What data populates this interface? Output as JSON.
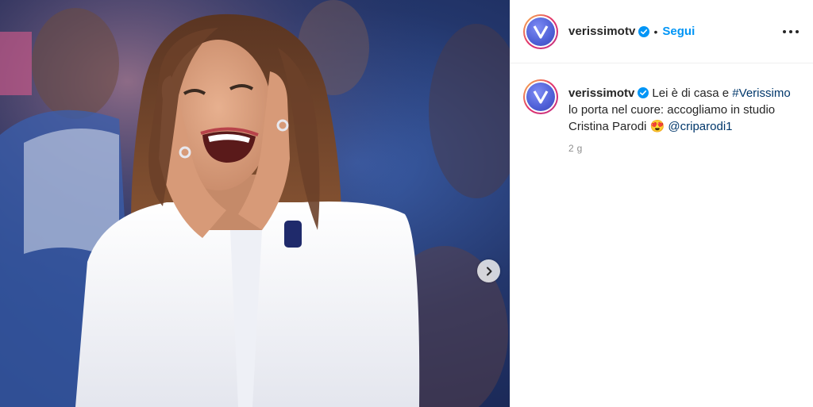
{
  "post": {
    "username": "verissimotv",
    "separator": "•",
    "follow_label": "Segui",
    "caption": {
      "text_1": "Lei è di casa e ",
      "hashtag": "#Verissimo",
      "text_2": " lo porta nel cuore: accogliamo in studio Cristina Parodi ",
      "emoji": "😍",
      "mention": "@criparodi1"
    },
    "timestamp": "2 g"
  },
  "icons": {
    "verified": "verified-badge-icon",
    "more": "more-options-icon",
    "next": "chevron-right-icon",
    "avatar_logo": "verissimo-logo"
  },
  "colors": {
    "link_blue": "#0095f6",
    "hashtag_color": "#00376b",
    "verified_blue": "#0095f6",
    "text": "#262626",
    "muted": "#8e8e8e"
  }
}
